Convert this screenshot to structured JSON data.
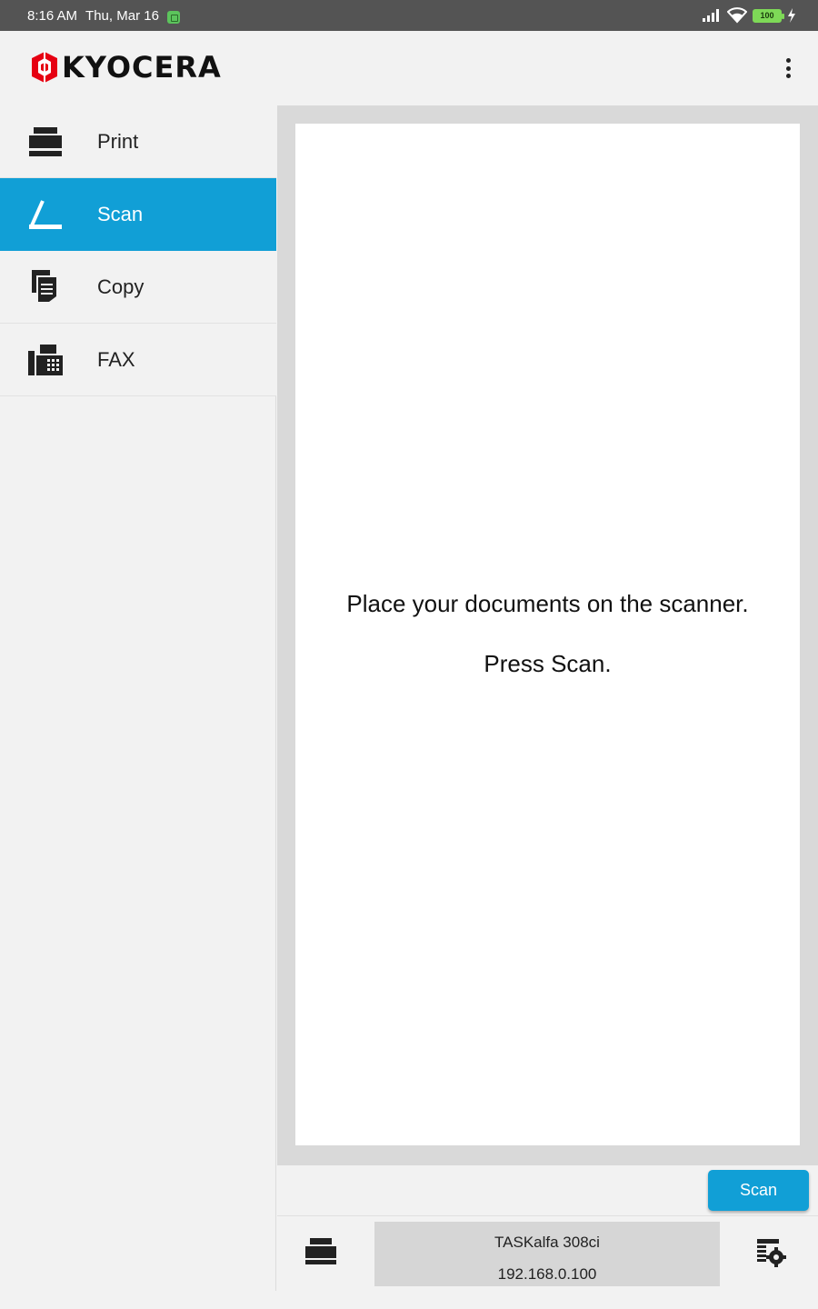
{
  "status_bar": {
    "time": "8:16 AM",
    "date": "Thu, Mar 16",
    "battery": "100"
  },
  "app_bar": {
    "logo_text": "KYOCERA"
  },
  "sidebar": {
    "items": [
      {
        "label": "Print",
        "icon": "printer-icon",
        "active": false
      },
      {
        "label": "Scan",
        "icon": "scanner-icon",
        "active": true
      },
      {
        "label": "Copy",
        "icon": "copy-icon",
        "active": false
      },
      {
        "label": "FAX",
        "icon": "fax-icon",
        "active": false
      }
    ]
  },
  "main": {
    "instruction_line1": "Place your documents on the scanner.",
    "instruction_line2": "Press Scan."
  },
  "actions": {
    "scan_label": "Scan"
  },
  "device": {
    "name": "TASKalfa 308ci",
    "ip": "192.168.0.100"
  },
  "colors": {
    "accent": "#119fd6",
    "brand_red": "#e60012",
    "status_bar": "#545454"
  }
}
